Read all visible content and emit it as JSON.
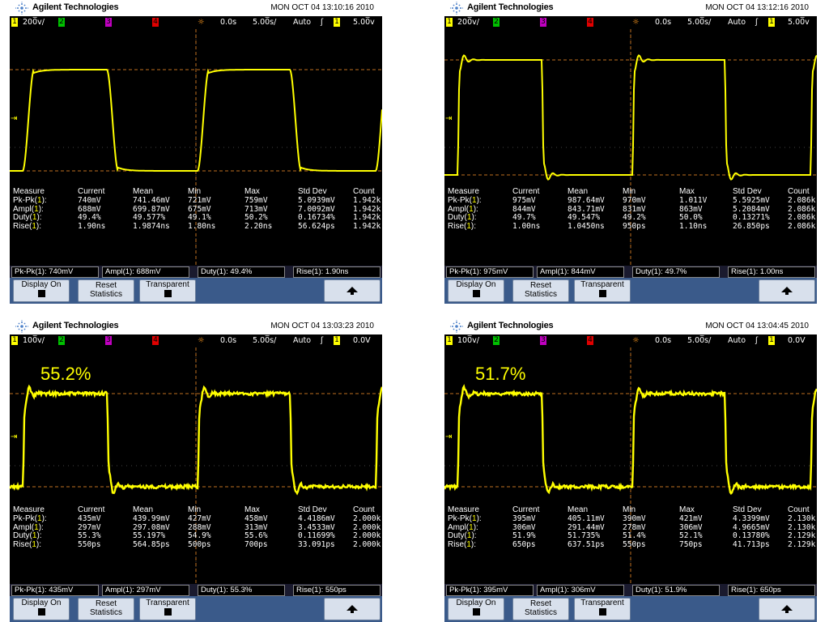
{
  "panels": [
    {
      "brand": "Agilent Technologies",
      "datetime": "MON OCT 04 13:10:16 2010",
      "status": {
        "ch1_label": "1",
        "scale": "200̅v/",
        "ch2_label": "2",
        "ch3_label": "3",
        "ch4_label": "4",
        "delay": "0.0s",
        "timebase": "5.00̅s/",
        "mode": "Auto",
        "trig_slope": "ʃ",
        "trig_ch": "1",
        "trig_level": "5.00̅v"
      },
      "percent_label": "",
      "waveform": "square_smooth",
      "table": {
        "headers": [
          "Measure",
          "Current",
          "Mean",
          "Min",
          "Max",
          "Std Dev",
          "Count"
        ],
        "rows": [
          {
            "name": "Pk-Pk(",
            "ch": "1",
            "suffix": "):",
            "values": [
              "740mV",
              "741.46mV",
              "721mV",
              "759mV",
              "5.0939mV",
              "1.942k"
            ]
          },
          {
            "name": "Ampl(",
            "ch": "1",
            "suffix": "):",
            "values": [
              "688mV",
              "699.87mV",
              "675mV",
              "713mV",
              "7.0092mV",
              "1.942k"
            ]
          },
          {
            "name": "Duty(",
            "ch": "1",
            "suffix": "):",
            "values": [
              "49.4%",
              "49.577%",
              "49.1%",
              "50.2%",
              "0.16734%",
              "1.942k"
            ]
          },
          {
            "name": "Rise(",
            "ch": "1",
            "suffix": "):",
            "values": [
              "1.90ns",
              "1.9874ns",
              "1.80ns",
              "2.20ns",
              "56.624ps",
              "1.942k"
            ]
          }
        ]
      },
      "summary": {
        "pkpk": "Pk-Pk(1): 740mV",
        "ampl": "Ampl(1): 688mV",
        "duty": "Duty(1): 49.4%",
        "rise": "Rise(1): 1.90ns"
      },
      "softkeys": {
        "display": "Display On",
        "reset_line1": "Reset",
        "reset_line2": "Statistics",
        "transparent": "Transparent"
      }
    },
    {
      "brand": "Agilent Technologies",
      "datetime": "MON OCT 04 13:12:16 2010",
      "status": {
        "ch1_label": "1",
        "scale": "200̅v/",
        "ch2_label": "2",
        "ch3_label": "3",
        "ch4_label": "4",
        "delay": "0.0s",
        "timebase": "5.00̅s/",
        "mode": "Auto",
        "trig_slope": "ʃ",
        "trig_ch": "1",
        "trig_level": "5.00̅v"
      },
      "percent_label": "",
      "waveform": "square_ringing",
      "table": {
        "headers": [
          "Measure",
          "Current",
          "Mean",
          "Min",
          "Max",
          "Std Dev",
          "Count"
        ],
        "rows": [
          {
            "name": "Pk-Pk(",
            "ch": "1",
            "suffix": "):",
            "values": [
              "975mV",
              "987.64mV",
              "970mV",
              "1.011V",
              "5.5925mV",
              "2.086k"
            ]
          },
          {
            "name": "Ampl(",
            "ch": "1",
            "suffix": "):",
            "values": [
              "844mV",
              "843.71mV",
              "831mV",
              "863mV",
              "5.2084mV",
              "2.086k"
            ]
          },
          {
            "name": "Duty(",
            "ch": "1",
            "suffix": "):",
            "values": [
              "49.7%",
              "49.547%",
              "49.2%",
              "50.0%",
              "0.13271%",
              "2.086k"
            ]
          },
          {
            "name": "Rise(",
            "ch": "1",
            "suffix": "):",
            "values": [
              "1.00ns",
              "1.0450ns",
              "950ps",
              "1.10ns",
              "26.850ps",
              "2.086k"
            ]
          }
        ]
      },
      "summary": {
        "pkpk": "Pk-Pk(1): 975mV",
        "ampl": "Ampl(1): 844mV",
        "duty": "Duty(1): 49.7%",
        "rise": "Rise(1): 1.00ns"
      },
      "softkeys": {
        "display": "Display On",
        "reset_line1": "Reset",
        "reset_line2": "Statistics",
        "transparent": "Transparent"
      }
    },
    {
      "brand": "Agilent Technologies",
      "datetime": "MON OCT 04 13:03:23 2010",
      "status": {
        "ch1_label": "1",
        "scale": "100̅v/",
        "ch2_label": "2",
        "ch3_label": "3",
        "ch4_label": "4",
        "delay": "0.0s",
        "timebase": "5.00̅s/",
        "mode": "Auto",
        "trig_slope": "ʃ",
        "trig_ch": "1",
        "trig_level": "0.0V"
      },
      "percent_label": "55.2%",
      "waveform": "square_noisy",
      "table": {
        "headers": [
          "Measure",
          "Current",
          "Mean",
          "Min",
          "Max",
          "Std Dev",
          "Count"
        ],
        "rows": [
          {
            "name": "Pk-Pk(",
            "ch": "1",
            "suffix": "):",
            "values": [
              "435mV",
              "439.99mV",
              "427mV",
              "458mV",
              "4.4186mV",
              "2.000k"
            ]
          },
          {
            "name": "Ampl(",
            "ch": "1",
            "suffix": "):",
            "values": [
              "297mV",
              "297.08mV",
              "288mV",
              "313mV",
              "3.4533mV",
              "2.000k"
            ]
          },
          {
            "name": "Duty(",
            "ch": "1",
            "suffix": "):",
            "values": [
              "55.3%",
              "55.197%",
              "54.9%",
              "55.6%",
              "0.11699%",
              "2.000k"
            ]
          },
          {
            "name": "Rise(",
            "ch": "1",
            "suffix": "):",
            "values": [
              "550ps",
              "564.85ps",
              "500ps",
              "700ps",
              "33.091ps",
              "2.000k"
            ]
          }
        ]
      },
      "summary": {
        "pkpk": "Pk-Pk(1): 435mV",
        "ampl": "Ampl(1): 297mV",
        "duty": "Duty(1): 55.3%",
        "rise": "Rise(1): 550ps"
      },
      "softkeys": {
        "display": "Display On",
        "reset_line1": "Reset",
        "reset_line2": "Statistics",
        "transparent": "Transparent"
      }
    },
    {
      "brand": "Agilent Technologies",
      "datetime": "MON OCT 04 13:04:45 2010",
      "status": {
        "ch1_label": "1",
        "scale": "100̅v/",
        "ch2_label": "2",
        "ch3_label": "3",
        "ch4_label": "4",
        "delay": "0.0s",
        "timebase": "5.00̅s/",
        "mode": "Auto",
        "trig_slope": "ʃ",
        "trig_ch": "1",
        "trig_level": "0.0V"
      },
      "percent_label": "51.7%",
      "waveform": "square_noisy",
      "table": {
        "headers": [
          "Measure",
          "Current",
          "Mean",
          "Min",
          "Max",
          "Std Dev",
          "Count"
        ],
        "rows": [
          {
            "name": "Pk-Pk(",
            "ch": "1",
            "suffix": "):",
            "values": [
              "395mV",
              "405.11mV",
              "390mV",
              "421mV",
              "4.3399mV",
              "2.130k"
            ]
          },
          {
            "name": "Ampl(",
            "ch": "1",
            "suffix": "):",
            "values": [
              "306mV",
              "291.44mV",
              "278mV",
              "306mV",
              "4.9665mV",
              "2.130k"
            ]
          },
          {
            "name": "Duty(",
            "ch": "1",
            "suffix": "):",
            "values": [
              "51.9%",
              "51.735%",
              "51.4%",
              "52.1%",
              "0.13780%",
              "2.129k"
            ]
          },
          {
            "name": "Rise(",
            "ch": "1",
            "suffix": "):",
            "values": [
              "650ps",
              "637.51ps",
              "550ps",
              "750ps",
              "41.713ps",
              "2.129k"
            ]
          }
        ]
      },
      "summary": {
        "pkpk": "Pk-Pk(1): 395mV",
        "ampl": "Ampl(1): 306mV",
        "duty": "Duty(1): 51.9%",
        "rise": "Rise(1): 650ps"
      },
      "softkeys": {
        "display": "Display On",
        "reset_line1": "Reset",
        "reset_line2": "Statistics",
        "transparent": "Transparent"
      }
    }
  ],
  "colors": {
    "trace": "#ffff00",
    "ch2": "#00c000",
    "ch3": "#c000c0",
    "ch4": "#e00000",
    "grid": "#7a5a2a",
    "softkey_bar": "#3a5a8a"
  }
}
